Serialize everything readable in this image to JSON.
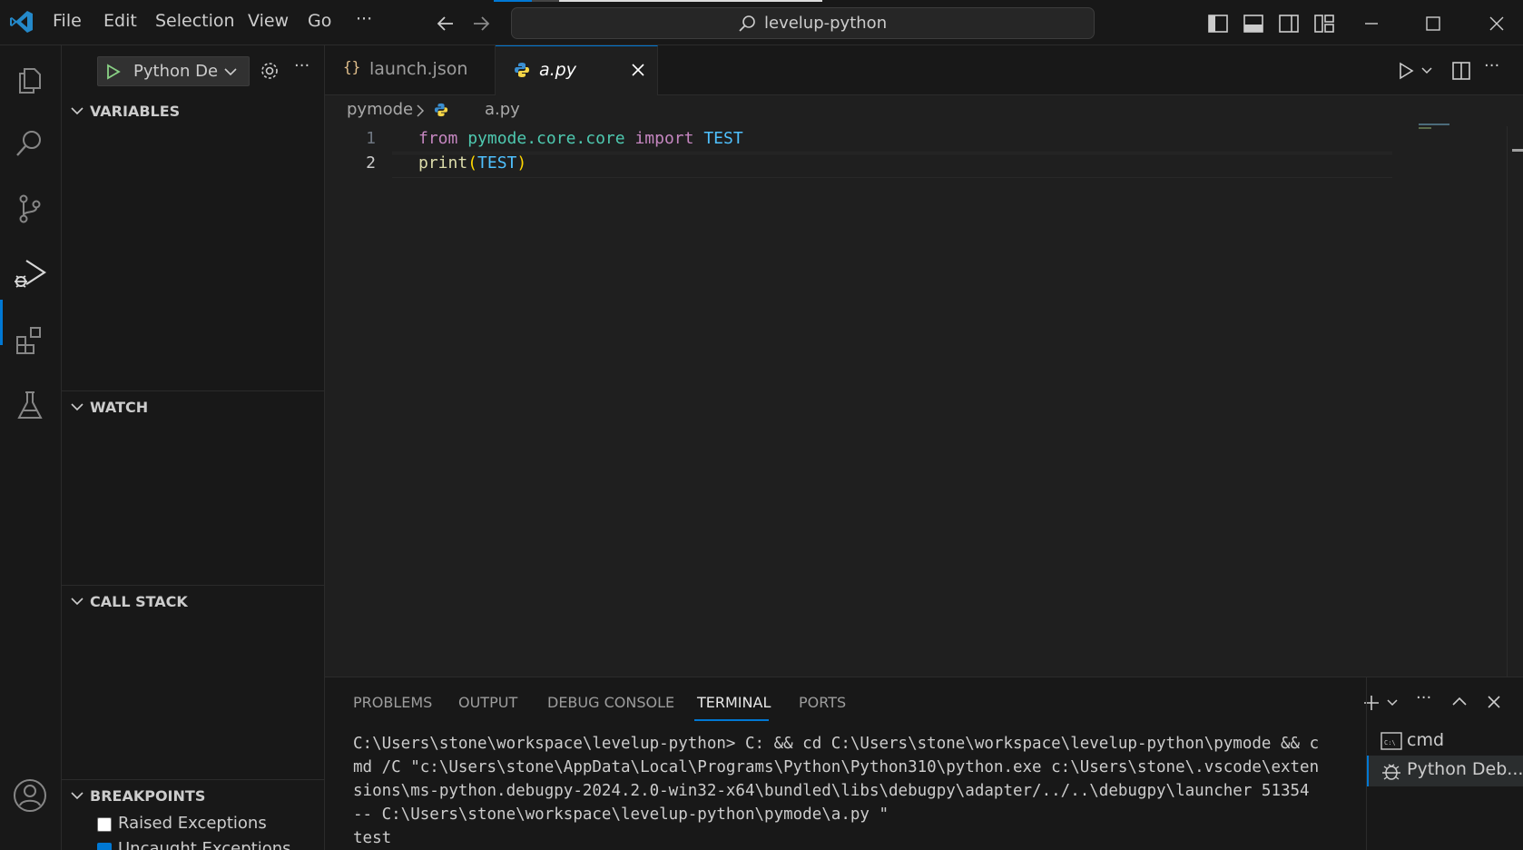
{
  "menu": {
    "file": "File",
    "edit": "Edit",
    "selection": "Selection",
    "view": "View",
    "go": "Go",
    "more": "···"
  },
  "title_search": "levelup-python",
  "sidebar": {
    "debug_config": "Python De",
    "variables": "VARIABLES",
    "watch": "WATCH",
    "call_stack": "CALL STACK",
    "breakpoints": "BREAKPOINTS",
    "bp_items": [
      {
        "label": "Raised Exceptions",
        "checked": false
      },
      {
        "label": "Uncaught Exceptions",
        "checked": true
      }
    ]
  },
  "tabs": [
    {
      "label": "launch.json",
      "icon": "braces"
    },
    {
      "label": "a.py",
      "icon": "python"
    }
  ],
  "breadcrumb": {
    "folder": "pymode",
    "file": "a.py"
  },
  "code": {
    "line_numbers": [
      "1",
      "2"
    ],
    "line1": {
      "kw1": "from",
      "mod": "pymode.core.core",
      "kw2": "import",
      "const": "TEST"
    },
    "line2": {
      "fn": "print",
      "open": "(",
      "arg": "TEST",
      "close": ")"
    }
  },
  "panel": {
    "tabs": [
      "PROBLEMS",
      "OUTPUT",
      "DEBUG CONSOLE",
      "TERMINAL",
      "PORTS"
    ],
    "active_tab": "TERMINAL",
    "terminal_output": "C:\\Users\\stone\\workspace\\levelup-python> C: && cd C:\\Users\\stone\\workspace\\levelup-python\\pymode && cmd /C \"c:\\Users\\stone\\AppData\\Local\\Programs\\Python\\Python310\\python.exe c:\\Users\\stone\\.vscode\\extensions\\ms-python.debugpy-2024.2.0-win32-x64\\bundled\\libs\\debugpy\\adapter/../..\\debugpy\\launcher 51354 -- C:\\Users\\stone\\workspace\\levelup-python\\pymode\\a.py \"\ntest",
    "terminals": [
      "cmd",
      "Python Deb..."
    ]
  },
  "colors": {
    "accent": "#0078d4",
    "keyword": "#c586c0",
    "module": "#4ec9b0",
    "constant": "#4fc1ff"
  }
}
